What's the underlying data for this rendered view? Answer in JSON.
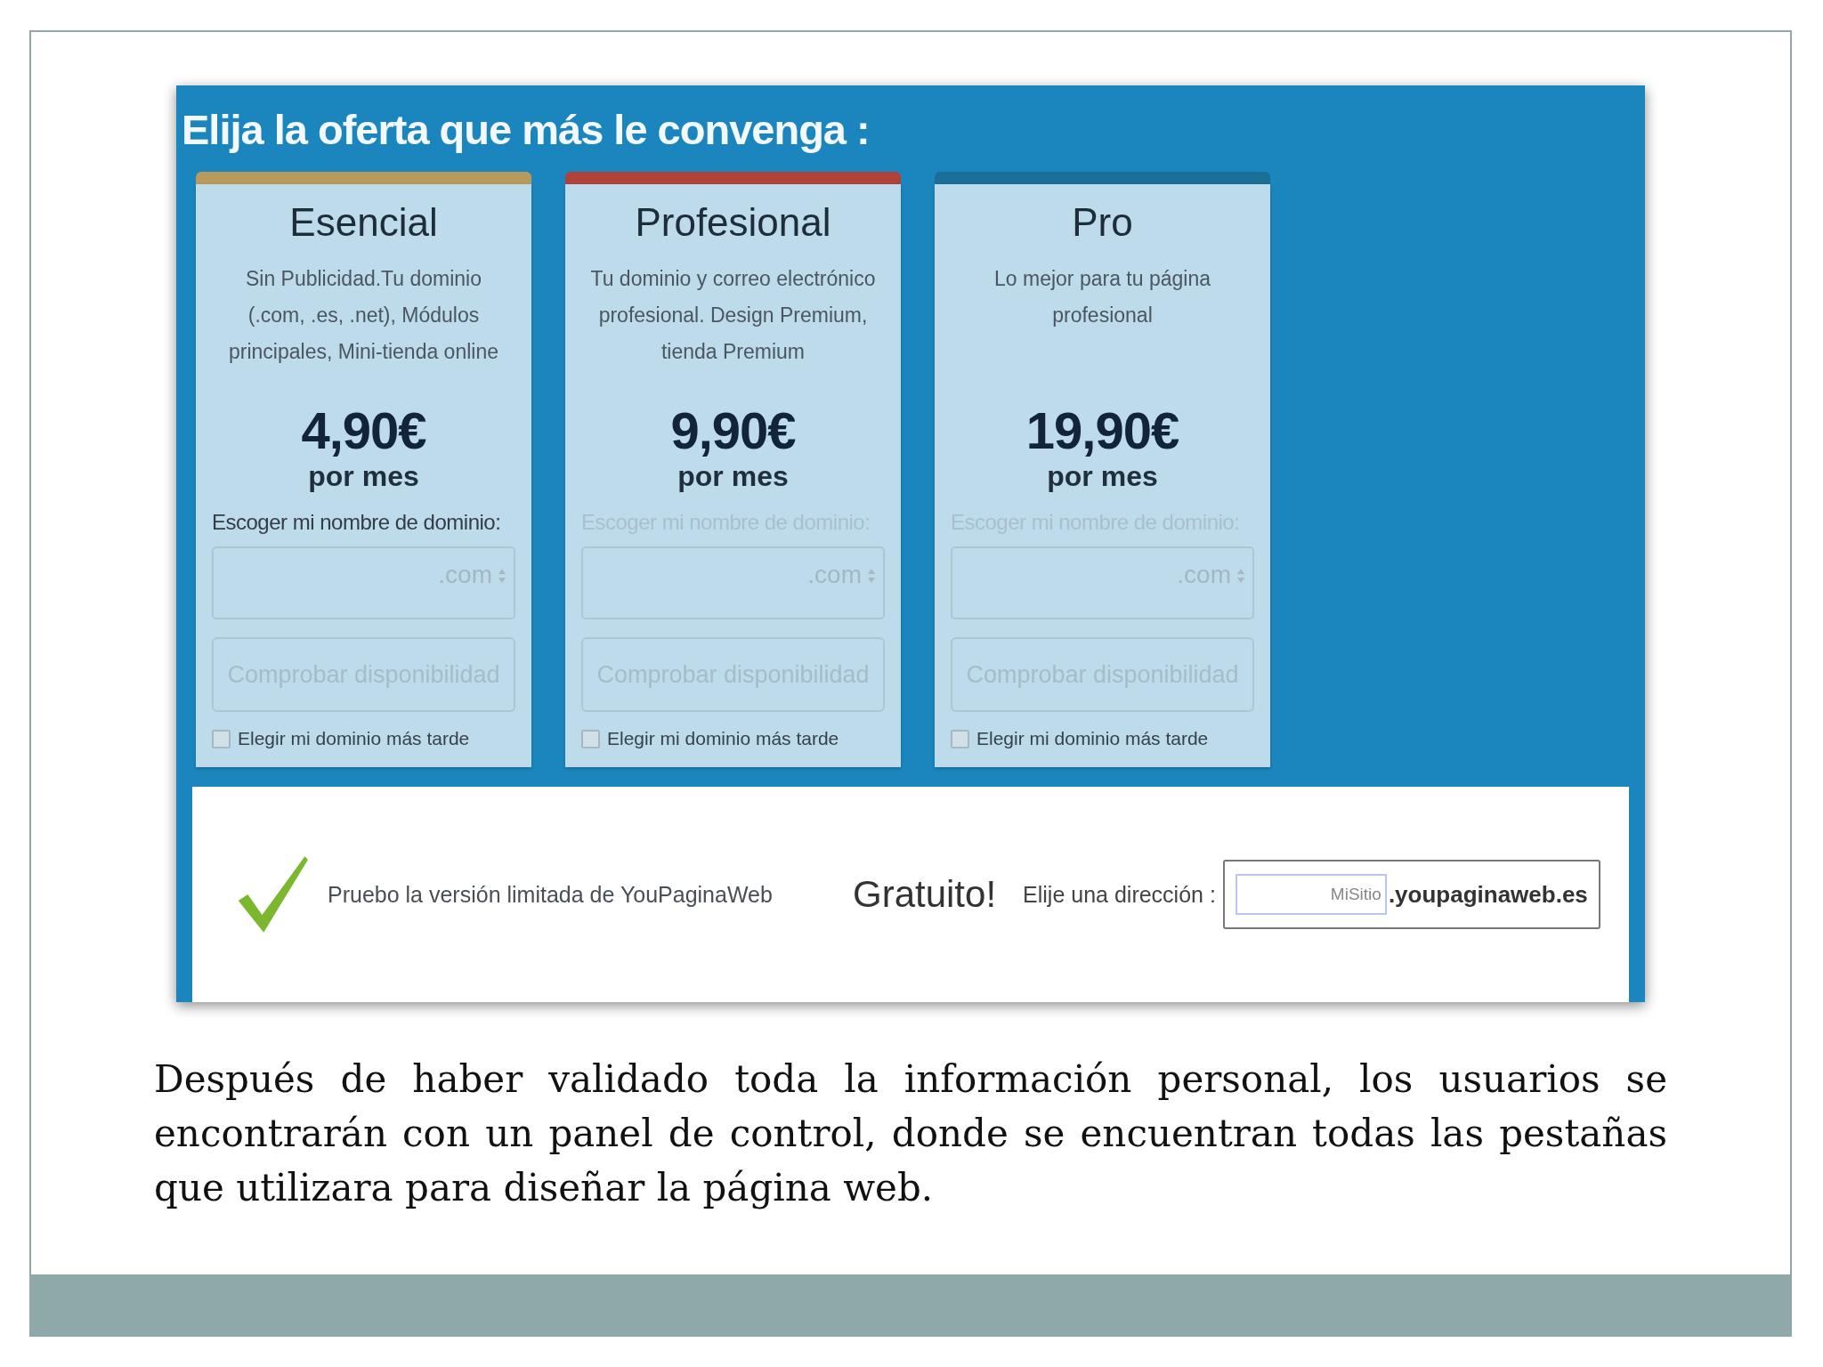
{
  "screenshot": {
    "title": "Elija la oferta que más le convenga :",
    "plans": [
      {
        "name": "Esencial",
        "description": "Sin Publicidad.Tu dominio (.com, .es, .net), Módulos principales, Mini-tienda online",
        "price": "4,90€",
        "period": "por mes",
        "domain_label": "Escoger mi nombre de dominio:",
        "label_disabled": false,
        "tld": ".com",
        "check_button": "Comprobar disponibilidad",
        "later_label": "Elegir mi dominio más tarde",
        "later_checked": false,
        "color": "#b89a5a"
      },
      {
        "name": "Profesional",
        "description": "Tu dominio y correo electrónico profesional. Design Premium, tienda Premium",
        "price": "9,90€",
        "period": "por mes",
        "domain_label": "Escoger mi nombre de dominio:",
        "label_disabled": true,
        "tld": ".com",
        "check_button": "Comprobar disponibilidad",
        "later_label": "Elegir mi dominio más tarde",
        "later_checked": false,
        "color": "#b0423a"
      },
      {
        "name": "Pro",
        "description": "Lo mejor para tu página profesional",
        "price": "19,90€",
        "period": "por mes",
        "domain_label": "Escoger mi nombre de dominio:",
        "label_disabled": true,
        "tld": ".com",
        "check_button": "Comprobar disponibilidad",
        "later_label": "Elegir mi dominio más tarde",
        "later_checked": false,
        "color": "#1a6f96"
      }
    ],
    "free_bar": {
      "text": "Pruebo la versión limitada de YouPaginaWeb",
      "badge": "Gratuito!",
      "address_label": "Elije una dirección :",
      "address_value": "MiSitio",
      "domain_suffix": ".youpaginaweb.es"
    }
  },
  "caption": "Después de haber validado toda la información personal, los usuarios se encontrarán con un panel de control, donde se encuentran todas las pestañas que utilizara para diseñar la página web."
}
